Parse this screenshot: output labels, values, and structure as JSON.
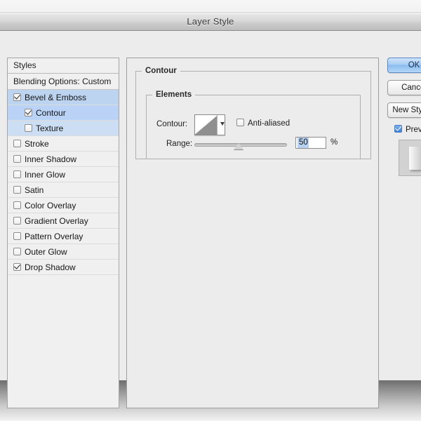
{
  "window": {
    "title": "Layer Style"
  },
  "styles_panel": {
    "header_label": "Styles",
    "blending_options_label": "Blending Options: Custom",
    "effects": [
      {
        "label": "Bevel & Emboss",
        "checked": true,
        "selected": false,
        "indent": false
      },
      {
        "label": "Contour",
        "checked": true,
        "selected": true,
        "indent": true
      },
      {
        "label": "Texture",
        "checked": false,
        "selected": true,
        "indent": true
      },
      {
        "label": "Stroke",
        "checked": false,
        "selected": false,
        "indent": false
      },
      {
        "label": "Inner Shadow",
        "checked": false,
        "selected": false,
        "indent": false
      },
      {
        "label": "Inner Glow",
        "checked": false,
        "selected": false,
        "indent": false
      },
      {
        "label": "Satin",
        "checked": false,
        "selected": false,
        "indent": false
      },
      {
        "label": "Color Overlay",
        "checked": false,
        "selected": false,
        "indent": false
      },
      {
        "label": "Gradient Overlay",
        "checked": false,
        "selected": false,
        "indent": false
      },
      {
        "label": "Pattern Overlay",
        "checked": false,
        "selected": false,
        "indent": false
      },
      {
        "label": "Outer Glow",
        "checked": false,
        "selected": false,
        "indent": false
      },
      {
        "label": "Drop Shadow",
        "checked": true,
        "selected": false,
        "indent": false
      }
    ]
  },
  "contour_panel": {
    "group_title": "Contour",
    "elements_title": "Elements",
    "contour_label": "Contour:",
    "contour_swatch_icon": "contour-ramp-swatch",
    "contour_dropdown_icon": "chevron-down-icon",
    "anti_aliased_label": "Anti-aliased",
    "anti_aliased_checked": false,
    "range_label": "Range:",
    "range_value": "50",
    "range_unit": "%",
    "range_min": 0,
    "range_max": 100
  },
  "buttons": {
    "ok_label": "OK",
    "cancel_label": "Cancel",
    "new_style_label": "New Style...",
    "preview_label": "Preview",
    "preview_checked": true,
    "preview_thumbnail_icon": "layer-preview-thumbnail"
  },
  "colors": {
    "accent_blue": "#8bbcf0",
    "selection_blue": "#b9d2f5",
    "dialog_bg": "#ececec",
    "panel_border": "#9e9e9e",
    "text": "#1a1a1a"
  }
}
